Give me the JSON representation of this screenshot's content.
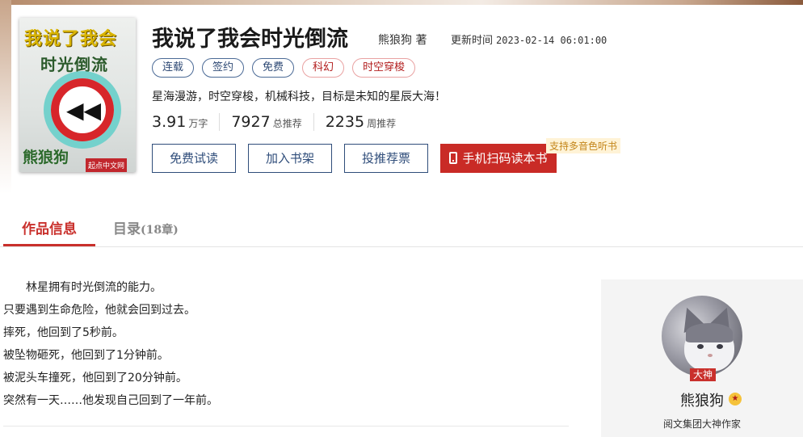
{
  "book": {
    "cover": {
      "title_line1": "我说了我会",
      "title_line2": "时光倒流",
      "author": "熊狼狗",
      "publisher_logo": "起点中文网"
    },
    "title": "我说了我会时光倒流",
    "author": "熊狼狗 著",
    "update_label": "更新时间",
    "update_time": "2023-02-14 06:01:00",
    "tags": [
      {
        "label": "连载",
        "style": "blue"
      },
      {
        "label": "签约",
        "style": "blue"
      },
      {
        "label": "免费",
        "style": "blue"
      },
      {
        "label": "科幻",
        "style": "red"
      },
      {
        "label": "时空穿梭",
        "style": "red"
      }
    ],
    "intro": "星海漫游，时空穿梭，机械科技，目标是未知的星辰大海！",
    "stats": [
      {
        "value": "3.91",
        "unit": "万字"
      },
      {
        "value": "7927",
        "unit": "总推荐"
      },
      {
        "value": "2235",
        "unit": "周推荐"
      }
    ]
  },
  "actions": {
    "read_free": "免费试读",
    "add_shelf": "加入书架",
    "vote": "投推荐票",
    "mobile_read": "手机扫码读本书",
    "audio_badge": "支持多音色听书"
  },
  "tabs": {
    "info": "作品信息",
    "catalog": "目录",
    "catalog_count": "(18章)"
  },
  "description": [
    "林星拥有时光倒流的能力。",
    "只要遇到生命危险，他就会回到过去。",
    "摔死，他回到了5秒前。",
    "被坠物砸死，他回到了1分钟前。",
    "被泥头车撞死，他回到了20分钟前。",
    "突然有一天……他发现自己回到了一年前。"
  ],
  "author_panel": {
    "badge": "大神",
    "name": "熊狼狗",
    "subtitle": "阅文集团大神作家"
  },
  "colors": {
    "accent_red": "#c9302c",
    "button_blue": "#2f4d7a",
    "tag_blue": "#4b6a96",
    "audio_badge": "#c4861b"
  }
}
